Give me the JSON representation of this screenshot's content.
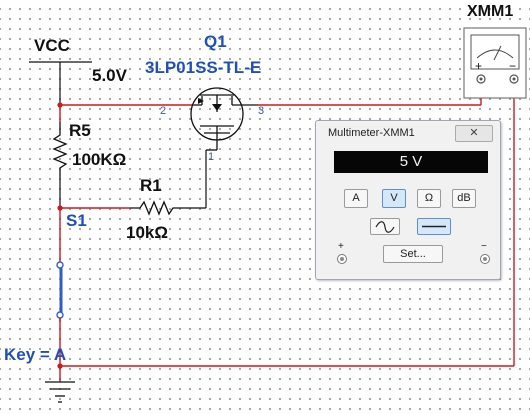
{
  "labels": {
    "vcc": "VCC",
    "vcc_value": "5.0V",
    "q1_ref": "Q1",
    "q1_part": "3LP01SS-TL-E",
    "r5_ref": "R5",
    "r5_value": "100KΩ",
    "r1_ref": "R1",
    "r1_value": "10kΩ",
    "s1_ref": "S1",
    "key": "Key = A",
    "xmm_ref": "XMM1",
    "pin2": "2",
    "pin3": "3",
    "pin1": "1",
    "xmm_plus": "+",
    "xmm_minus": "−"
  },
  "multimeter": {
    "title": "Multimeter-XMM1",
    "reading": "5 V",
    "buttons": [
      "A",
      "V",
      "Ω",
      "dB"
    ],
    "selected_button": "V",
    "selected_mode": "DC",
    "set_label": "Set...",
    "plus": "+",
    "minus": "−"
  },
  "colors": {
    "wire": "#d4171b",
    "wire_blue": "#2f5bd0",
    "label_blue": "#1f4fbf",
    "component": "#111111"
  },
  "icons": [
    "ac-wave-icon",
    "dc-line-icon",
    "meter-needle-icon",
    "ground-icon",
    "mosfet-symbol",
    "resistor-symbol",
    "switch-symbol"
  ]
}
